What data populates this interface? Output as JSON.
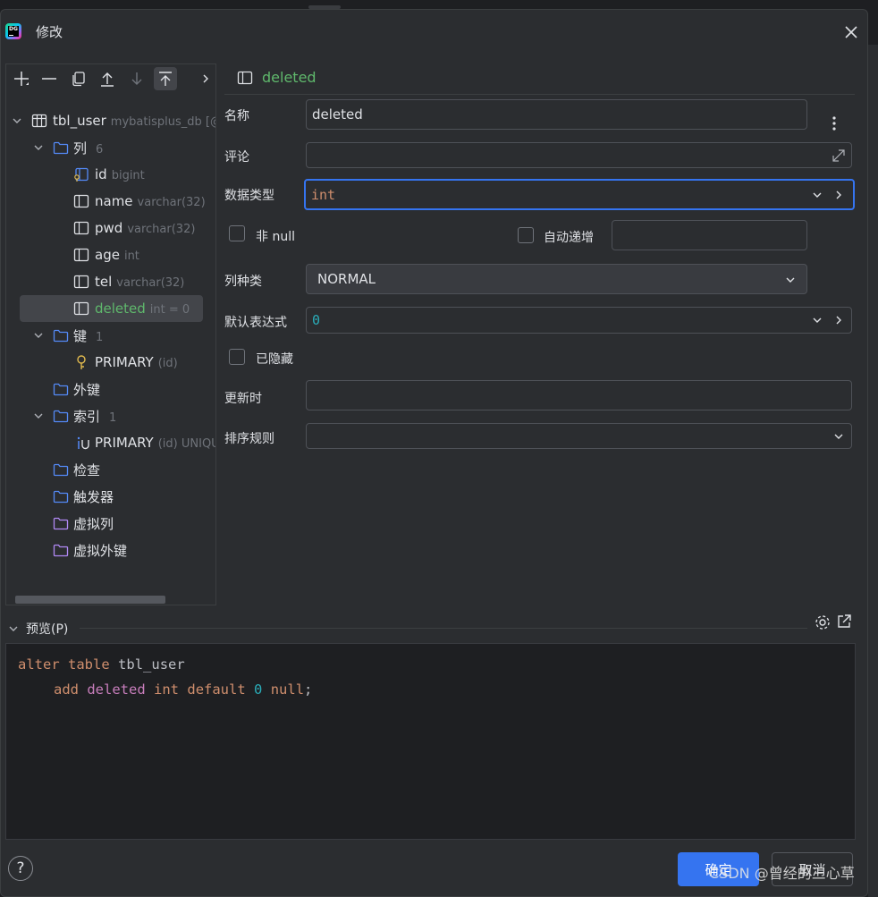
{
  "window": {
    "title": "修改"
  },
  "tree": {
    "table": {
      "name": "tbl_user",
      "meta": "mybatisplus_db [@"
    },
    "columns_folder": {
      "label": "列",
      "count": "6"
    },
    "columns": [
      {
        "name": "id",
        "type": "bigint"
      },
      {
        "name": "name",
        "type": "varchar(32)"
      },
      {
        "name": "pwd",
        "type": "varchar(32)"
      },
      {
        "name": "age",
        "type": "int"
      },
      {
        "name": "tel",
        "type": "varchar(32)"
      },
      {
        "name": "deleted",
        "type": "int = 0"
      }
    ],
    "keys_folder": {
      "label": "键",
      "count": "1"
    },
    "key": {
      "name": "PRIMARY",
      "meta": "(id)"
    },
    "foreign_keys": {
      "label": "外键"
    },
    "indexes_folder": {
      "label": "索引",
      "count": "1"
    },
    "index": {
      "name": "PRIMARY",
      "meta": "(id) UNIQU"
    },
    "checks": {
      "label": "检查"
    },
    "triggers": {
      "label": "触发器"
    },
    "virtual_columns": {
      "label": "虚拟列"
    },
    "virtual_foreign_keys": {
      "label": "虚拟外键"
    }
  },
  "form": {
    "header": "deleted",
    "name_label": "名称",
    "name_value": "deleted",
    "comment_label": "评论",
    "comment_value": "",
    "datatype_label": "数据类型",
    "datatype_value": "int",
    "notnull_label": "非 null",
    "autoinc_label": "自动递增",
    "autoinc_value": "",
    "kind_label": "列种类",
    "kind_value": "NORMAL",
    "default_label": "默认表达式",
    "default_value": "0",
    "hidden_label": "已隐藏",
    "onupdate_label": "更新时",
    "onupdate_value": "",
    "collation_label": "排序规则",
    "collation_value": ""
  },
  "preview": {
    "label": "预览(P)",
    "line1": {
      "kw1": "alter",
      "kw2": "table",
      "name": "tbl_user"
    },
    "line2": {
      "kw1": "add",
      "col": "deleted",
      "type": "int",
      "kw2": "default",
      "num": "0",
      "kw3": "null",
      "end": ";"
    }
  },
  "buttons": {
    "help": "?",
    "ok": "确定",
    "cancel": "取消"
  },
  "watermark": "CSDN @曾经的三心草",
  "colors": {
    "accent": "#3574f0",
    "selected_text": "#5fb86c",
    "keyword": "#cf8e6d",
    "identifier": "#c77dbb",
    "number": "#2aacb8"
  }
}
